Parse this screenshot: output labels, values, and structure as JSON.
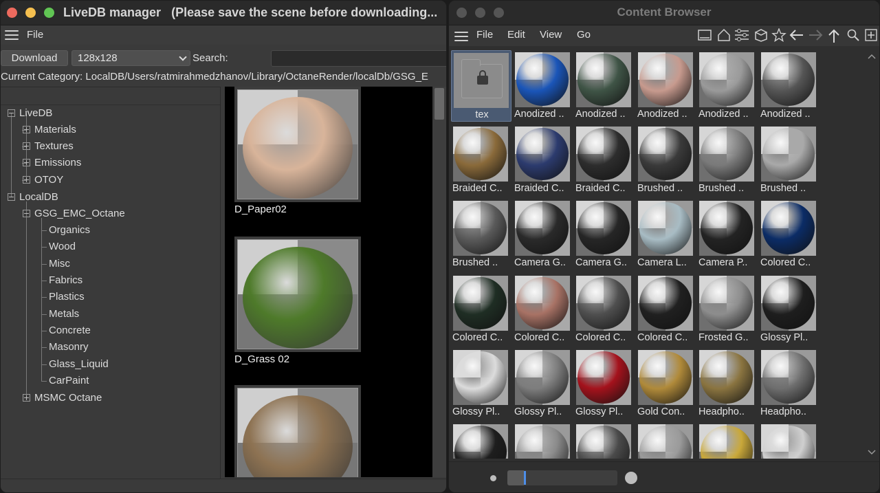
{
  "livedb": {
    "title": "LiveDB manager",
    "subtitle": "(Please save the scene before downloading...",
    "menu": {
      "file": "File"
    },
    "toolbar": {
      "download_label": "Download",
      "size_value": "128x128",
      "search_label": "Search:",
      "search_value": ""
    },
    "current_category": "Current Category: LocalDB/Users/ratmirahmedzhanov/Library/OctaneRender/localDb/GSG_E",
    "tree": {
      "livedb": "LiveDB",
      "materials": "Materials",
      "textures": "Textures",
      "emissions": "Emissions",
      "otoy": "OTOY",
      "localdb": "LocalDB",
      "gsg": "GSG_EMC_Octane",
      "organics": "Organics",
      "wood": "Wood",
      "misc": "Misc",
      "fabrics": "Fabrics",
      "plastics": "Plastics",
      "metals": "Metals",
      "concrete": "Concrete",
      "masonry": "Masonry",
      "glass_liquid": "Glass_Liquid",
      "carpaint": "CarPaint",
      "msmc": "MSMC Octane"
    },
    "thumbs": [
      {
        "name": "D_Paper02",
        "color": "#d8b49a"
      },
      {
        "name": "D_Grass 02",
        "color": "#4e7a2a"
      },
      {
        "name": "",
        "color": "#8d7252"
      }
    ]
  },
  "content_browser": {
    "title": "Content Browser",
    "menu": {
      "file": "File",
      "edit": "Edit",
      "view": "View",
      "go": "Go"
    },
    "toolbar_icons": [
      "hamburger-icon",
      "panel-icon",
      "home-icon",
      "sliders-icon",
      "box-icon",
      "star-icon",
      "back-arrow-icon",
      "forward-arrow-icon",
      "up-arrow-icon",
      "search-icon",
      "add-icon"
    ],
    "items": [
      {
        "label": "tex",
        "kind": "folder"
      },
      {
        "label": "Anodized ..",
        "color": "#1a55b8"
      },
      {
        "label": "Anodized ..",
        "color": "#3f5446"
      },
      {
        "label": "Anodized ..",
        "color": "#c79a8e"
      },
      {
        "label": "Anodized ..",
        "color": "#9a9a9a"
      },
      {
        "label": "Anodized ..",
        "color": "#555555"
      },
      {
        "label": "Braided C..",
        "color": "#8a6a3a"
      },
      {
        "label": "Braided C..",
        "color": "#2c3b6e"
      },
      {
        "label": "Braided C..",
        "color": "#2d2d2d"
      },
      {
        "label": "Brushed ..",
        "color": "#3a3a3a"
      },
      {
        "label": "Brushed ..",
        "color": "#7a7a7a"
      },
      {
        "label": "Brushed ..",
        "color": "#a9a9a9"
      },
      {
        "label": "Brushed ..",
        "color": "#5a5a5a"
      },
      {
        "label": "Camera G..",
        "color": "#2a2a2a"
      },
      {
        "label": "Camera G..",
        "color": "#262626"
      },
      {
        "label": "Camera L..",
        "color": "#a8bcc4"
      },
      {
        "label": "Camera P..",
        "color": "#232323"
      },
      {
        "label": "Colored C..",
        "color": "#0b2c66"
      },
      {
        "label": "Colored C..",
        "color": "#1f2e24"
      },
      {
        "label": "Colored C..",
        "color": "#a87265"
      },
      {
        "label": "Colored C..",
        "color": "#4f4f4f"
      },
      {
        "label": "Colored C..",
        "color": "#202020"
      },
      {
        "label": "Frosted G..",
        "color": "#8d8d8d"
      },
      {
        "label": "Glossy Pl..",
        "color": "#1e1e1e"
      },
      {
        "label": "Glossy Pl..",
        "color": "#dcdcdc"
      },
      {
        "label": "Glossy Pl..",
        "color": "#7d7d7d"
      },
      {
        "label": "Glossy Pl..",
        "color": "#a4121c"
      },
      {
        "label": "Gold Con..",
        "color": "#b08a3a"
      },
      {
        "label": "Headpho..",
        "color": "#8a7440"
      },
      {
        "label": "Headpho..",
        "color": "#6e6e6e"
      },
      {
        "label": "",
        "color": "#1e1e1e"
      },
      {
        "label": "",
        "color": "#8a8a8a"
      },
      {
        "label": "",
        "color": "#4a4a4a"
      },
      {
        "label": "",
        "color": "#9a9a9a"
      },
      {
        "label": "",
        "color": "#c9a83a"
      },
      {
        "label": "",
        "color": "#cfcfcf"
      }
    ],
    "zoom_level": 0.15
  }
}
